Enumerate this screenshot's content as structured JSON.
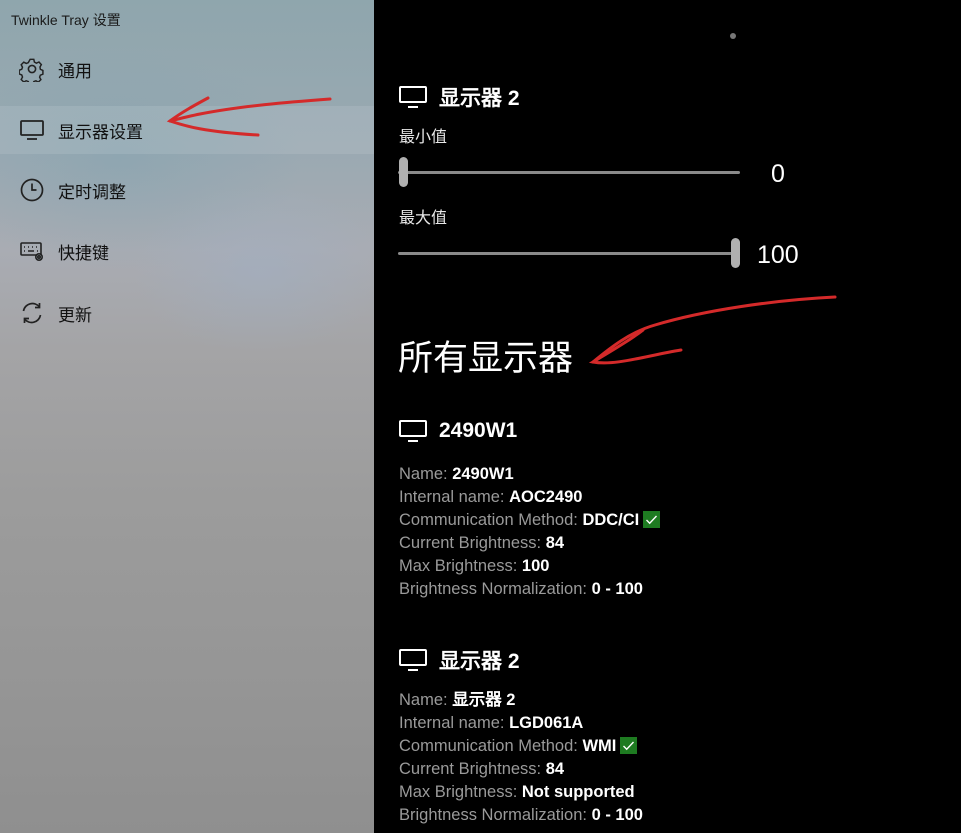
{
  "app": {
    "title": "Twinkle Tray 设置"
  },
  "sidebar": {
    "items": [
      {
        "label": "通用",
        "icon": "gear-icon"
      },
      {
        "label": "显示器设置",
        "icon": "monitor-icon",
        "active": true
      },
      {
        "label": "定时调整",
        "icon": "clock-icon"
      },
      {
        "label": "快捷键",
        "icon": "keyboard-icon"
      },
      {
        "label": "更新",
        "icon": "refresh-icon"
      }
    ]
  },
  "limits_monitor": {
    "name": "显示器 2",
    "min_label": "最小值",
    "min_value": "0",
    "max_label": "最大值",
    "max_value": "100"
  },
  "all_monitors": {
    "title": "所有显示器",
    "monitors": [
      {
        "name": "2490W1",
        "rows": [
          {
            "label": "Name:",
            "value": "2490W1"
          },
          {
            "label": "Internal name:",
            "value": "AOC2490"
          },
          {
            "label": "Communication Method:",
            "value": "DDC/CI",
            "badge": "check-icon"
          },
          {
            "label": "Current Brightness:",
            "value": "84"
          },
          {
            "label": "Max Brightness:",
            "value": "100"
          },
          {
            "label": "Brightness Normalization:",
            "value": "0 - 100"
          }
        ]
      },
      {
        "name": "显示器 2",
        "rows": [
          {
            "label": "Name:",
            "value": "显示器 2"
          },
          {
            "label": "Internal name:",
            "value": "LGD061A"
          },
          {
            "label": "Communication Method:",
            "value": "WMI",
            "badge": "check-icon"
          },
          {
            "label": "Current Brightness:",
            "value": "84"
          },
          {
            "label": "Max Brightness:",
            "value": "Not supported"
          },
          {
            "label": "Brightness Normalization:",
            "value": "0 - 100"
          }
        ]
      }
    ]
  },
  "colors": {
    "annotation_red": "#d42a2a",
    "check_green": "#1e7b21"
  }
}
